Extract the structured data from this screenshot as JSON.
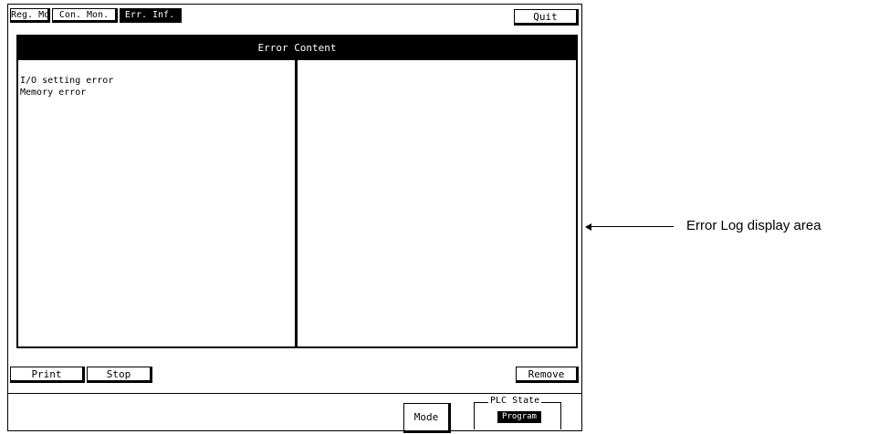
{
  "tabs": [
    {
      "label": "Reg. Mon.",
      "active": false
    },
    {
      "label": "Con. Mon.",
      "active": false
    },
    {
      "label": "Err. Inf.",
      "active": true
    }
  ],
  "quit_label": "Quit",
  "panel": {
    "title": "Error Content",
    "errors": [
      "I/O setting error",
      "Memory error"
    ]
  },
  "buttons": {
    "print": "Print",
    "stop": "Stop",
    "remove": "Remove",
    "mode": "Mode"
  },
  "plc_state": {
    "title": "PLC State",
    "value": "Program"
  },
  "annotation": "Error Log display area"
}
